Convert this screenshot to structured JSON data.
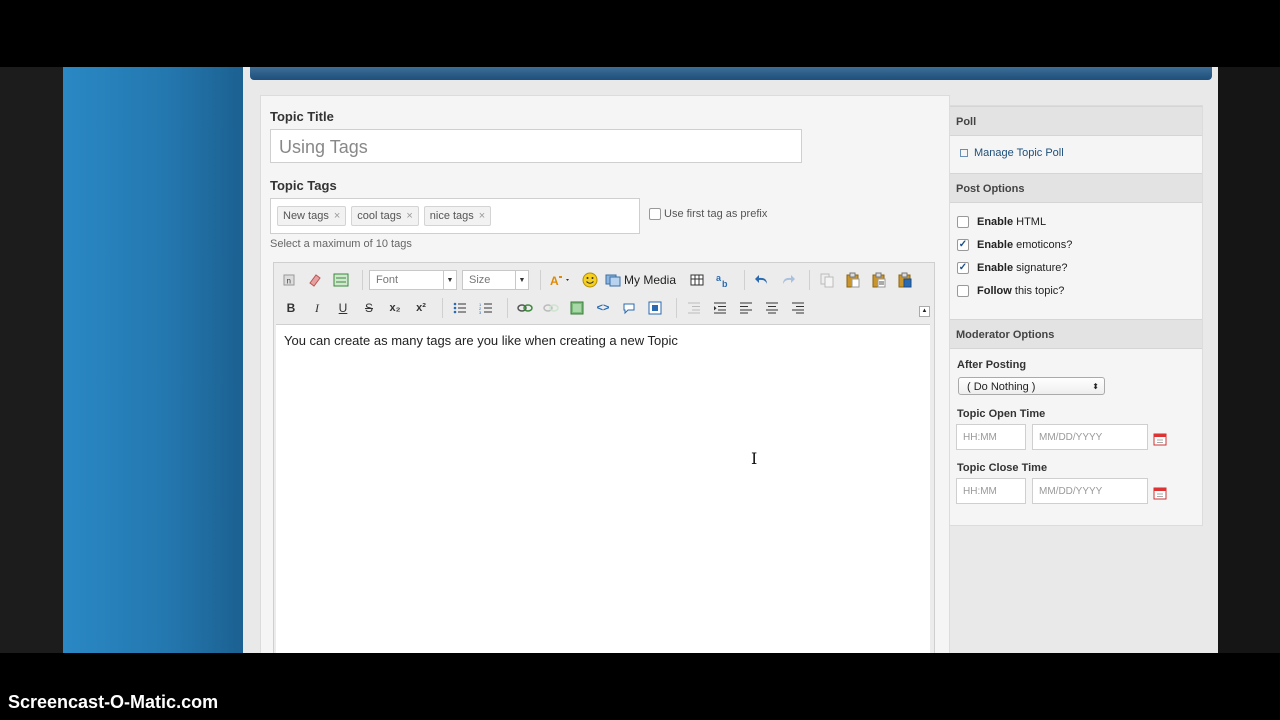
{
  "topic": {
    "title_label": "Topic Title",
    "title_value": "Using Tags",
    "tags_label": "Topic Tags",
    "tags": [
      "New tags",
      "cool tags",
      "nice tags"
    ],
    "tag_remove": "×",
    "prefix_label": "Use first tag as prefix",
    "hint": "Select a maximum of 10 tags"
  },
  "toolbar": {
    "font_placeholder": "Font",
    "size_placeholder": "Size",
    "my_media": "My Media",
    "bold": "B",
    "italic": "I",
    "underline": "U",
    "strike": "S",
    "subscript": "x₂",
    "superscript": "x²"
  },
  "editor": {
    "content": "You can create as many tags are you like when creating a new Topic"
  },
  "sidebar": {
    "poll_header": "Poll",
    "manage_poll": "Manage Topic Poll",
    "post_options_header": "Post Options",
    "options": [
      {
        "bold": "Enable",
        "rest": " HTML",
        "checked": false
      },
      {
        "bold": "Enable",
        "rest": " emoticons?",
        "checked": true
      },
      {
        "bold": "Enable",
        "rest": " signature?",
        "checked": true
      },
      {
        "bold": "Follow",
        "rest": " this topic?",
        "checked": false
      }
    ],
    "mod_header": "Moderator Options",
    "after_posting_label": "After Posting",
    "after_posting_value": "( Do Nothing )",
    "open_time_label": "Topic Open Time",
    "close_time_label": "Topic Close Time",
    "time_placeholder": "HH:MM",
    "date_placeholder": "MM/DD/YYYY"
  },
  "watermark": "Screencast-O-Matic.com",
  "colors": {
    "accent": "#1f4f7a",
    "check": "#1a4e8c",
    "sidebar_blue": "#2478b0"
  }
}
